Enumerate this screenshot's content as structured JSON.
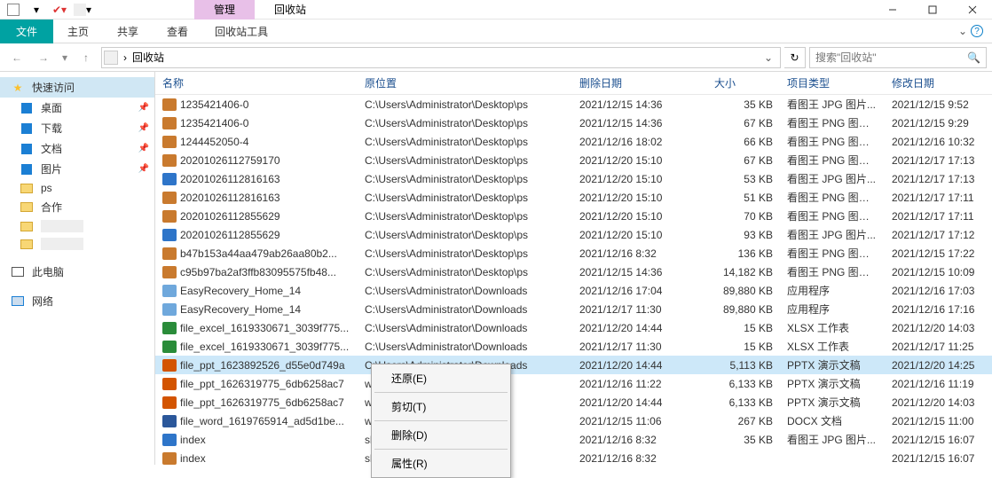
{
  "window": {
    "manage_tab": "管理",
    "location_tab": "回收站",
    "min": "—",
    "max": "☐",
    "close": "✕"
  },
  "ribbon": {
    "file": "文件",
    "home": "主页",
    "share": "共享",
    "view": "查看",
    "tools": "回收站工具"
  },
  "nav": {
    "breadcrumb_sep": "›",
    "location": "回收站",
    "search_placeholder": "搜索\"回收站\""
  },
  "sidebar": {
    "quick": "快速访问",
    "items": [
      {
        "label": "桌面",
        "pin": true,
        "icon": "blue"
      },
      {
        "label": "下载",
        "pin": true,
        "icon": "blue"
      },
      {
        "label": "文档",
        "pin": true,
        "icon": "blue"
      },
      {
        "label": "图片",
        "pin": true,
        "icon": "blue"
      },
      {
        "label": "ps",
        "pin": false,
        "icon": "folder"
      },
      {
        "label": "合作",
        "pin": false,
        "icon": "folder"
      },
      {
        "label": "",
        "pin": false,
        "icon": "folder",
        "smear": true
      },
      {
        "label": "",
        "pin": false,
        "icon": "folder",
        "smear": true
      }
    ],
    "thispc": "此电脑",
    "network": "网络"
  },
  "columns": {
    "name": "名称",
    "orig": "原位置",
    "del": "删除日期",
    "size": "大小",
    "type": "项目类型",
    "mod": "修改日期"
  },
  "rows": [
    {
      "icon": "png",
      "name": "1235421406-0",
      "orig": "C:\\Users\\Administrator\\Desktop\\ps",
      "del": "2021/12/15 14:36",
      "size": "35 KB",
      "type": "看图王 JPG 图片...",
      "mod": "2021/12/15 9:52",
      "cut": true
    },
    {
      "icon": "png",
      "name": "1235421406-0",
      "orig": "C:\\Users\\Administrator\\Desktop\\ps",
      "del": "2021/12/15 14:36",
      "size": "67 KB",
      "type": "看图王 PNG 图片...",
      "mod": "2021/12/15 9:29"
    },
    {
      "icon": "png",
      "name": "1244452050-4",
      "orig": "C:\\Users\\Administrator\\Desktop\\ps",
      "del": "2021/12/16 18:02",
      "size": "66 KB",
      "type": "看图王 PNG 图片...",
      "mod": "2021/12/16 10:32"
    },
    {
      "icon": "png",
      "name": "20201026112759170",
      "orig": "C:\\Users\\Administrator\\Desktop\\ps",
      "del": "2021/12/20 15:10",
      "size": "67 KB",
      "type": "看图王 PNG 图片...",
      "mod": "2021/12/17 17:13"
    },
    {
      "icon": "jpg",
      "name": "20201026112816163",
      "orig": "C:\\Users\\Administrator\\Desktop\\ps",
      "del": "2021/12/20 15:10",
      "size": "53 KB",
      "type": "看图王 JPG 图片...",
      "mod": "2021/12/17 17:13"
    },
    {
      "icon": "png",
      "name": "20201026112816163",
      "orig": "C:\\Users\\Administrator\\Desktop\\ps",
      "del": "2021/12/20 15:10",
      "size": "51 KB",
      "type": "看图王 PNG 图片...",
      "mod": "2021/12/17 17:11"
    },
    {
      "icon": "png",
      "name": "20201026112855629",
      "orig": "C:\\Users\\Administrator\\Desktop\\ps",
      "del": "2021/12/20 15:10",
      "size": "70 KB",
      "type": "看图王 PNG 图片...",
      "mod": "2021/12/17 17:11"
    },
    {
      "icon": "jpg",
      "name": "20201026112855629",
      "orig": "C:\\Users\\Administrator\\Desktop\\ps",
      "del": "2021/12/20 15:10",
      "size": "93 KB",
      "type": "看图王 JPG 图片...",
      "mod": "2021/12/17 17:12"
    },
    {
      "icon": "png",
      "name": "b47b153a44aa479ab26aa80b2...",
      "orig": "C:\\Users\\Administrator\\Desktop\\ps",
      "del": "2021/12/16 8:32",
      "size": "136 KB",
      "type": "看图王 PNG 图片...",
      "mod": "2021/12/15 17:22"
    },
    {
      "icon": "png",
      "name": "c95b97ba2af3ffb83095575fb48...",
      "orig": "C:\\Users\\Administrator\\Desktop\\ps",
      "del": "2021/12/15 14:36",
      "size": "14,182 KB",
      "type": "看图王 PNG 图片...",
      "mod": "2021/12/15 10:09"
    },
    {
      "icon": "exe",
      "name": "EasyRecovery_Home_14",
      "orig": "C:\\Users\\Administrator\\Downloads",
      "del": "2021/12/16 17:04",
      "size": "89,880 KB",
      "type": "应用程序",
      "mod": "2021/12/16 17:03"
    },
    {
      "icon": "exe",
      "name": "EasyRecovery_Home_14",
      "orig": "C:\\Users\\Administrator\\Downloads",
      "del": "2021/12/17 11:30",
      "size": "89,880 KB",
      "type": "应用程序",
      "mod": "2021/12/16 17:16"
    },
    {
      "icon": "xlsx",
      "name": "file_excel_1619330671_3039f775...",
      "orig": "C:\\Users\\Administrator\\Downloads",
      "del": "2021/12/20 14:44",
      "size": "15 KB",
      "type": "XLSX 工作表",
      "mod": "2021/12/20 14:03"
    },
    {
      "icon": "xlsx",
      "name": "file_excel_1619330671_3039f775...",
      "orig": "C:\\Users\\Administrator\\Downloads",
      "del": "2021/12/17 11:30",
      "size": "15 KB",
      "type": "XLSX 工作表",
      "mod": "2021/12/17 11:25"
    },
    {
      "icon": "pptx",
      "name": "file_ppt_1623892526_d55e0d749a",
      "orig": "C:\\Users\\Administrator\\Downloads",
      "del": "2021/12/20 14:44",
      "size": "5,113 KB",
      "type": "PPTX 演示文稿",
      "mod": "2021/12/20 14:25",
      "selected": true
    },
    {
      "icon": "pptx",
      "name": "file_ppt_1626319775_6db6258ac7",
      "orig": "wnloads",
      "del": "2021/12/16 11:22",
      "size": "6,133 KB",
      "type": "PPTX 演示文稿",
      "mod": "2021/12/16 11:19"
    },
    {
      "icon": "pptx",
      "name": "file_ppt_1626319775_6db6258ac7",
      "orig": "wnloads",
      "del": "2021/12/20 14:44",
      "size": "6,133 KB",
      "type": "PPTX 演示文稿",
      "mod": "2021/12/20 14:03"
    },
    {
      "icon": "docx",
      "name": "file_word_1619765914_ad5d1be...",
      "orig": "wnloads",
      "del": "2021/12/15 11:06",
      "size": "267 KB",
      "type": "DOCX 文档",
      "mod": "2021/12/15 11:00"
    },
    {
      "icon": "jpg",
      "name": "index",
      "orig": "sktop\\ps",
      "del": "2021/12/16 8:32",
      "size": "35 KB",
      "type": "看图王 JPG 图片...",
      "mod": "2021/12/15 16:07"
    },
    {
      "icon": "png",
      "name": "index",
      "orig": "sktop\\ps",
      "del": "2021/12/16 8:32",
      "size": "",
      "type": "",
      "mod": "2021/12/15 16:07"
    }
  ],
  "context_menu": {
    "restore": "还原(E)",
    "cut": "剪切(T)",
    "delete": "删除(D)",
    "properties": "属性(R)"
  }
}
